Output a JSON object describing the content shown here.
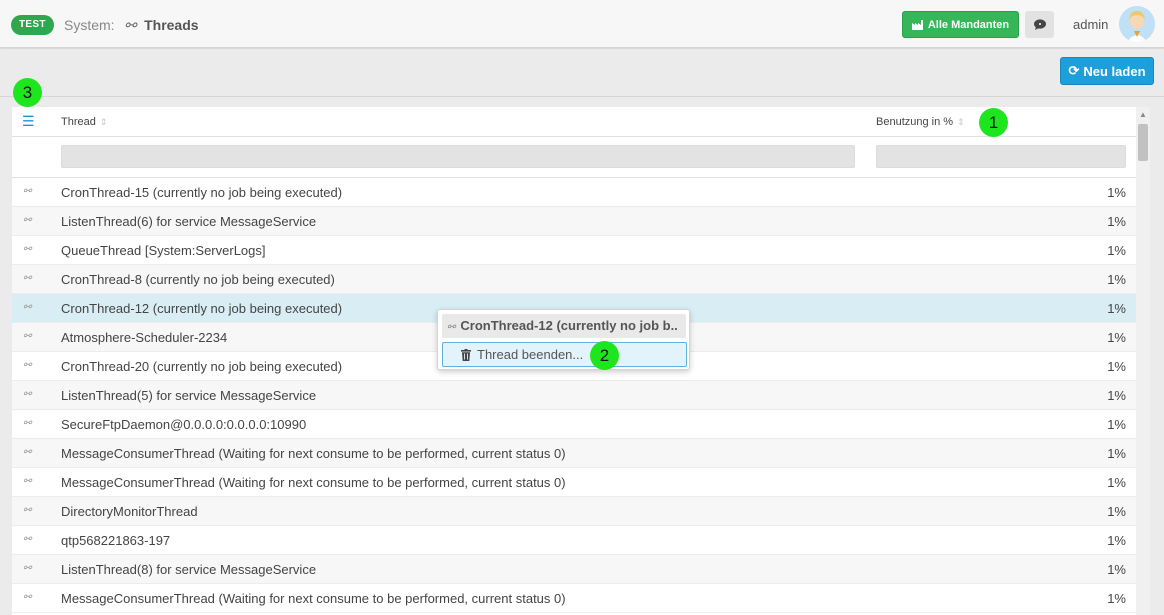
{
  "topbar": {
    "env_badge": "TEST",
    "breadcrumb_section": "System:",
    "breadcrumb_page": "Threads",
    "all_clients_button": "Alle Mandanten",
    "user_name": "admin"
  },
  "toolbar": {
    "reload_button": "Neu laden"
  },
  "grid": {
    "columns": {
      "thread": "Thread",
      "usage": "Benutzung in %"
    },
    "rows": [
      {
        "name": "CronThread-15 (currently no job being executed)",
        "usage": "1%"
      },
      {
        "name": "ListenThread(6) for service MessageService",
        "usage": "1%"
      },
      {
        "name": "QueueThread [System:ServerLogs]",
        "usage": "1%"
      },
      {
        "name": "CronThread-8 (currently no job being executed)",
        "usage": "1%"
      },
      {
        "name": "CronThread-12 (currently no job being executed)",
        "usage": "1%"
      },
      {
        "name": "Atmosphere-Scheduler-2234",
        "usage": "1%"
      },
      {
        "name": "CronThread-20 (currently no job being executed)",
        "usage": "1%"
      },
      {
        "name": "ListenThread(5) for service MessageService",
        "usage": "1%"
      },
      {
        "name": "SecureFtpDaemon@0.0.0.0:0.0.0.0:10990",
        "usage": "1%"
      },
      {
        "name": "MessageConsumerThread (Waiting for next consume to be performed, current status 0)",
        "usage": "1%"
      },
      {
        "name": "MessageConsumerThread (Waiting for next consume to be performed, current status 0)",
        "usage": "1%"
      },
      {
        "name": "DirectoryMonitorThread",
        "usage": "1%"
      },
      {
        "name": "qtp568221863-197",
        "usage": "1%"
      },
      {
        "name": "ListenThread(8) for service MessageService",
        "usage": "1%"
      },
      {
        "name": "MessageConsumerThread (Waiting for next consume to be performed, current status 0)",
        "usage": "1%"
      }
    ],
    "selected_row_index": 4
  },
  "context_menu": {
    "title": "CronThread-12 (currently no job b..",
    "item_terminate": "Thread beenden..."
  },
  "markers": {
    "m1": "1",
    "m2": "2",
    "m3": "3"
  },
  "colors": {
    "accent_green": "#35b658",
    "accent_blue": "#1e9fd9",
    "selection": "#d9edf5",
    "marker": "#1ee61e"
  }
}
